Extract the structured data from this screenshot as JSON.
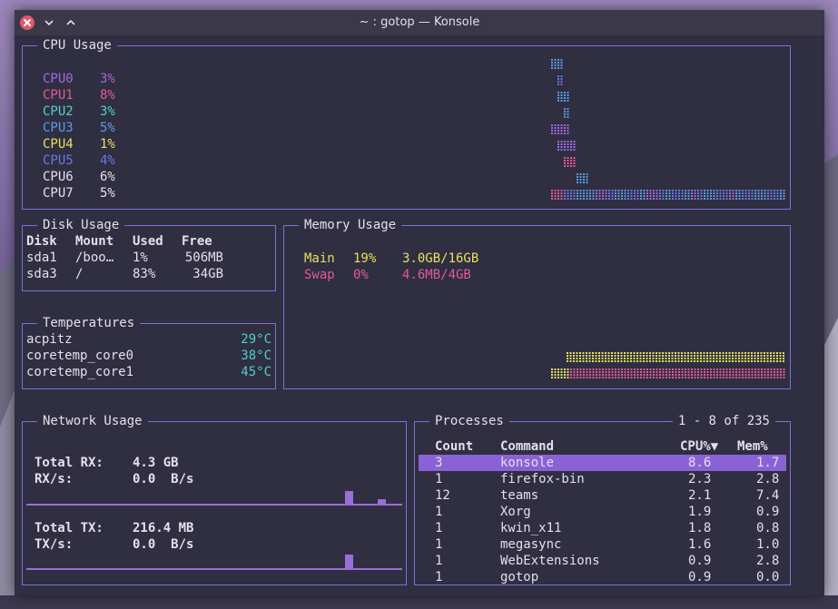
{
  "window": {
    "title": "~ : gotop — Konsole"
  },
  "cpu": {
    "title": "CPU Usage",
    "cores": [
      {
        "name": "CPU0",
        "value": "3%",
        "color": "#a06adf"
      },
      {
        "name": "CPU1",
        "value": "8%",
        "color": "#e05a9a"
      },
      {
        "name": "CPU2",
        "value": "3%",
        "color": "#4ed0d0"
      },
      {
        "name": "CPU3",
        "value": "5%",
        "color": "#5a9ce6"
      },
      {
        "name": "CPU4",
        "value": "1%",
        "color": "#e6e060"
      },
      {
        "name": "CPU5",
        "value": "4%",
        "color": "#6a78e6"
      },
      {
        "name": "CPU6",
        "value": "6%",
        "color": "#e3e1ec"
      },
      {
        "name": "CPU7",
        "value": "5%",
        "color": "#e3e1ec"
      }
    ]
  },
  "disk": {
    "title": "Disk Usage",
    "headers": [
      "Disk",
      "Mount",
      "Used",
      "Free"
    ],
    "rows": [
      [
        "sda1",
        "/boo…",
        "1%",
        "506MB"
      ],
      [
        "sda3",
        "/",
        "83%",
        "34GB"
      ]
    ]
  },
  "memory": {
    "title": "Memory Usage",
    "rows": [
      {
        "name": "Main",
        "pct": "19%",
        "amount": "3.0GB/16GB",
        "color": "#e6e060"
      },
      {
        "name": "Swap",
        "pct": "0%",
        "amount": "4.6MB/4GB",
        "color": "#e05a9a"
      }
    ]
  },
  "temps": {
    "title": "Temperatures",
    "rows": [
      {
        "name": "acpitz",
        "value": "29°C"
      },
      {
        "name": "coretemp_core0",
        "value": "38°C"
      },
      {
        "name": "coretemp_core1",
        "value": "45°C"
      }
    ]
  },
  "network": {
    "title": "Network Usage",
    "rx_total_label": "Total RX:",
    "rx_total": "4.3 GB",
    "rx_rate_label": "RX/s:",
    "rx_rate": "0.0  B/s",
    "tx_total_label": "Total TX:",
    "tx_total": "216.4 MB",
    "tx_rate_label": "TX/s:",
    "tx_rate": "0.0  B/s"
  },
  "processes": {
    "title": "Processes",
    "range": "1 - 8 of 235",
    "headers": {
      "count": "Count",
      "command": "Command",
      "cpu": "CPU%▼",
      "mem": "Mem%"
    },
    "selected_index": 0,
    "rows": [
      {
        "count": "3",
        "command": "konsole",
        "cpu": "8.6",
        "mem": "1.7"
      },
      {
        "count": "1",
        "command": "firefox-bin",
        "cpu": "2.3",
        "mem": "2.8"
      },
      {
        "count": "12",
        "command": "teams",
        "cpu": "2.1",
        "mem": "7.4"
      },
      {
        "count": "1",
        "command": "Xorg",
        "cpu": "1.9",
        "mem": "0.9"
      },
      {
        "count": "1",
        "command": "kwin_x11",
        "cpu": "1.8",
        "mem": "0.8"
      },
      {
        "count": "1",
        "command": "megasync",
        "cpu": "1.6",
        "mem": "1.0"
      },
      {
        "count": "1",
        "command": "WebExtensions",
        "cpu": "0.9",
        "mem": "2.8"
      },
      {
        "count": "1",
        "command": "gotop",
        "cpu": "0.9",
        "mem": "0.0"
      }
    ]
  },
  "colors": {
    "border": "#7a72d8",
    "temp_value": "#4ed0d0",
    "selected_row": "#8b62d6",
    "net_bars": "#9a6ed6"
  }
}
